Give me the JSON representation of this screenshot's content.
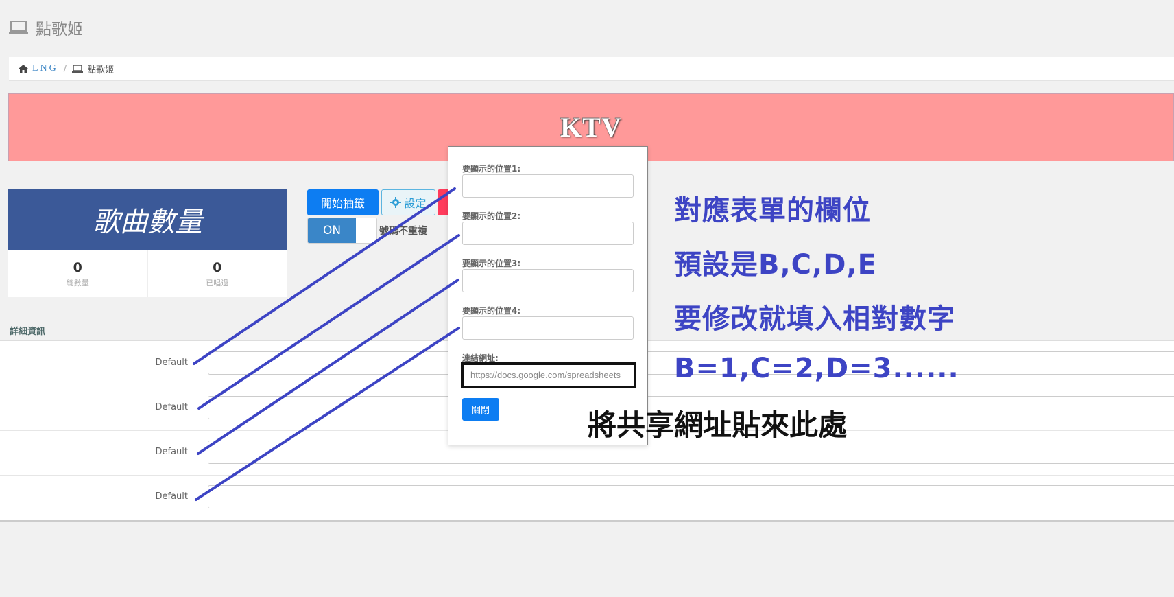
{
  "header": {
    "title": "點歌姬"
  },
  "breadcrumb": {
    "home": "LNG",
    "current": "點歌姬"
  },
  "banner": {
    "title": "KTV"
  },
  "stats": {
    "title": "歌曲數量",
    "items": [
      {
        "value": "0",
        "label": "總數量"
      },
      {
        "value": "0",
        "label": "已唱過"
      }
    ]
  },
  "toolbar": {
    "start_label": "開始抽籤",
    "settings_label": "設定",
    "toggle_label": "ON",
    "toggle_desc": "號碼不重複"
  },
  "detail": {
    "title": "詳細資訊",
    "rows": [
      {
        "label": "Default"
      },
      {
        "label": "Default"
      },
      {
        "label": "Default"
      },
      {
        "label": "Default"
      }
    ]
  },
  "modal": {
    "fields": [
      {
        "label": "要顯示的位置1:",
        "value": ""
      },
      {
        "label": "要顯示的位置2:",
        "value": ""
      },
      {
        "label": "要顯示的位置3:",
        "value": ""
      },
      {
        "label": "要顯示的位置4:",
        "value": ""
      }
    ],
    "url_label": "連結網址:",
    "url_placeholder": "https://docs.google.com/spreadsheets",
    "close_label": "關閉"
  },
  "annotations": {
    "lines": [
      "對應表單的欄位",
      "預設是B,C,D,E",
      "要修改就填入相對數字",
      "B=1,C=2,D=3......"
    ],
    "paste_note": "將共享網址貼來此處",
    "line_color": "#3d44c4"
  },
  "colors": {
    "banner": "#ff9999",
    "stats_header": "#3b5998",
    "primary": "#0d7df2",
    "toggle_on": "#3a86c8"
  }
}
